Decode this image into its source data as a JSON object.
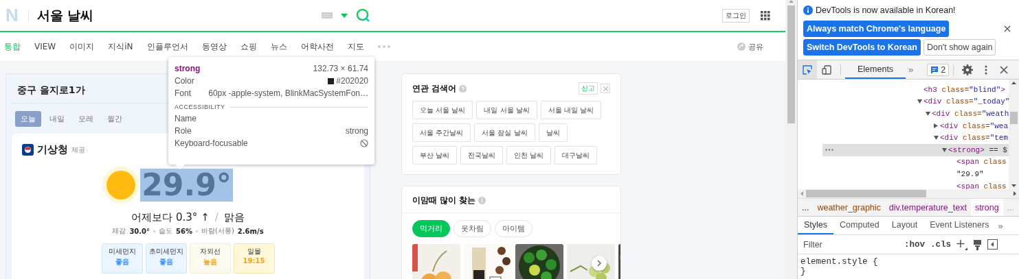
{
  "header": {
    "logo": "N",
    "title": "서울 날씨",
    "login": "로그인"
  },
  "nav": {
    "tabs": [
      {
        "label": "통합",
        "selected": true
      },
      {
        "label": "VIEW",
        "selected": false
      },
      {
        "label": "이미지",
        "selected": false
      },
      {
        "label": "지식iN",
        "selected": false
      },
      {
        "label": "인플루언서",
        "selected": false
      },
      {
        "label": "동영상",
        "selected": false
      },
      {
        "label": "쇼핑",
        "selected": false
      },
      {
        "label": "뉴스",
        "selected": false
      },
      {
        "label": "어학사전",
        "selected": false
      },
      {
        "label": "지도",
        "selected": false
      }
    ],
    "share": "공유"
  },
  "weather": {
    "location": "중구 을지로1가",
    "tabs": [
      {
        "label": "오늘",
        "selected": true
      },
      {
        "label": "내일",
        "selected": false
      },
      {
        "label": "모레",
        "selected": false
      },
      {
        "label": "월간",
        "selected": false
      }
    ],
    "provider": "기상청",
    "provider_note": "제공",
    "temperature": {
      "value": "29.9°",
      "highlighted": true
    },
    "comparison": "어제보다 0.3° ↑",
    "separator": "/",
    "condition": "맑음",
    "details": [
      {
        "label": "체감",
        "value": "30.0°"
      },
      {
        "label": "습도",
        "value": "56%"
      },
      {
        "label": "바람(서풍)",
        "value": "2.6m/s"
      }
    ],
    "indicators": [
      {
        "kind": "dust",
        "label": "미세먼지",
        "value": "좋음",
        "color": "#3e8ef7"
      },
      {
        "kind": "dust",
        "label": "초미세먼지",
        "value": "좋음",
        "color": "#3e8ef7"
      },
      {
        "kind": "uv",
        "label": "자외선",
        "value": "높음",
        "color": "#f6a01a"
      },
      {
        "kind": "sun",
        "label": "일몰",
        "value": "19:15",
        "color": "#f6a01a"
      }
    ]
  },
  "tooltip": {
    "element": "strong",
    "size": "132.73 × 61.74",
    "color_label": "Color",
    "color_value": "#202020",
    "font_label": "Font",
    "font_value": "60px -apple-system, BlinkMacSystemFon…",
    "section": "ACCESSIBILITY",
    "accessibility": [
      {
        "label": "Name"
      },
      {
        "label": "Role",
        "value": "strong"
      },
      {
        "label": "Keyboard-focusable",
        "focusable": false
      }
    ]
  },
  "related": {
    "title": "연관 검색어",
    "report": "신고",
    "items": [
      "오늘 서울 날씨",
      "내일 서울 날씨",
      "서울 내일 날씨",
      "서울 주간날씨",
      "서울 잠실 날씨",
      "날씨",
      "부산 날씨",
      "전국날씨",
      "인천 날씨",
      "대구날씨"
    ]
  },
  "popular": {
    "title": "이맘때 많이 찾는",
    "tabs": [
      {
        "label": "먹거리",
        "selected": true
      },
      {
        "label": "옷차림",
        "selected": false
      },
      {
        "label": "아이템",
        "selected": false
      }
    ]
  },
  "devtools": {
    "notice": "DevTools is now available in Korean!",
    "buttons": [
      {
        "label": "Always match Chrome's language",
        "kind": "primary"
      },
      {
        "label": "Switch DevTools to Korean",
        "kind": "primary"
      },
      {
        "label": "Don't show again",
        "kind": "plain"
      }
    ],
    "tabs": [
      {
        "label": "Elements",
        "selected": true
      }
    ],
    "more_tabs": "»",
    "issues": "2",
    "tree": [
      {
        "selected": false,
        "parts": [
          {
            "t": "<h3",
            "kind": "tag"
          },
          {
            "t": " class=",
            "kind": "attr"
          },
          {
            "t": "\"blind\"",
            "kind": "value"
          },
          {
            "t": ">",
            "kind": "tag"
          }
        ]
      },
      {
        "selected": false,
        "expanded": true,
        "parts": [
          {
            "t": "<div",
            "kind": "tag"
          },
          {
            "t": " class=",
            "kind": "attr"
          },
          {
            "t": "\"_today\"",
            "kind": "value"
          }
        ],
        "children": [
          {
            "selected": false,
            "expanded": true,
            "parts": [
              {
                "t": "<div",
                "kind": "tag"
              },
              {
                "t": " class=",
                "kind": "attr"
              },
              {
                "t": "\"weath",
                "kind": "value"
              }
            ],
            "children": [
              {
                "selected": false,
                "expanded": false,
                "parts": [
                  {
                    "t": "<div",
                    "kind": "tag"
                  },
                  {
                    "t": " class=",
                    "kind": "attr"
                  },
                  {
                    "t": "\"wea",
                    "kind": "value"
                  }
                ]
              },
              {
                "selected": false,
                "expanded": true,
                "parts": [
                  {
                    "t": "<div",
                    "kind": "tag"
                  },
                  {
                    "t": " class=",
                    "kind": "attr"
                  },
                  {
                    "t": "\"tem",
                    "kind": "value"
                  }
                ],
                "children": [
                  {
                    "selected": true,
                    "expanded": true,
                    "parts": [
                      {
                        "t": "<strong>",
                        "kind": "tag"
                      },
                      {
                        "t": " == $",
                        "kind": "plain"
                      }
                    ],
                    "children": [
                      {
                        "selected": false,
                        "parts": [
                          {
                            "t": "<span",
                            "kind": "tag"
                          },
                          {
                            "t": " class",
                            "kind": "attr"
                          }
                        ]
                      },
                      {
                        "selected": false,
                        "parts": [
                          {
                            "t": "\"29.9\"",
                            "kind": "text"
                          }
                        ]
                      },
                      {
                        "selected": false,
                        "parts": [
                          {
                            "t": "<span",
                            "kind": "tag"
                          },
                          {
                            "t": " class",
                            "kind": "attr"
                          }
                        ]
                      }
                    ]
                  }
                ]
              }
            ]
          }
        ]
      }
    ],
    "crumbs": {
      "before": "...",
      "items": [
        {
          "label": "weather_graphic",
          "kind": "class",
          "selected": false
        },
        {
          "label": "div.temperature_text",
          "kind": "element",
          "selected": false
        },
        {
          "label": "strong",
          "kind": "element",
          "selected": true
        }
      ],
      "after": "..."
    },
    "pane_tabs": [
      {
        "label": "Styles",
        "selected": true
      },
      {
        "label": "Computed",
        "selected": false
      },
      {
        "label": "Layout",
        "selected": false
      },
      {
        "label": "Event Listeners",
        "selected": false
      }
    ],
    "pane_more": "»",
    "filter": {
      "placeholder": "Filter"
    },
    "hov": ":hov",
    "cls": ".cls",
    "rule": {
      "selector": "element.style",
      "open": "{",
      "close": "}"
    }
  }
}
